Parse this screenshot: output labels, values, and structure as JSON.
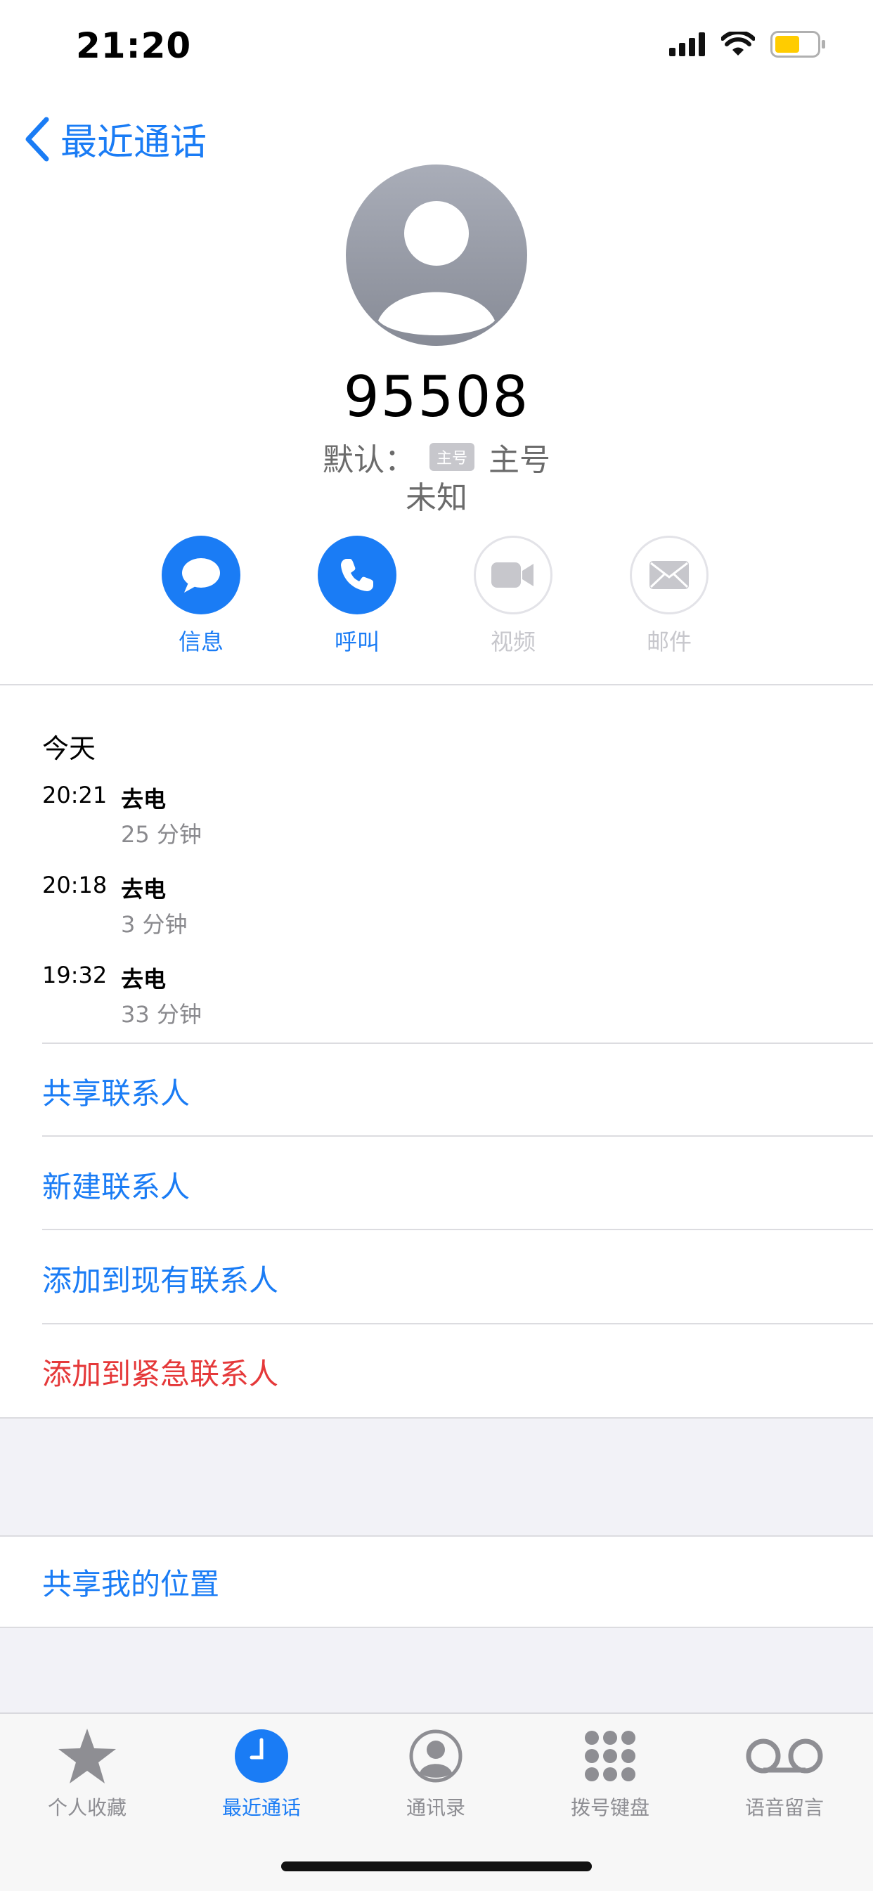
{
  "status_bar": {
    "time": "21:20"
  },
  "nav": {
    "back_label": "最近通话"
  },
  "contact": {
    "number": "95508",
    "default_label": "默认：",
    "tag": "主号",
    "line_label": "主号",
    "location": "未知"
  },
  "actions": [
    {
      "label": "信息",
      "icon": "message-icon",
      "enabled": true
    },
    {
      "label": "呼叫",
      "icon": "phone-icon",
      "enabled": true
    },
    {
      "label": "视频",
      "icon": "video-icon",
      "enabled": false
    },
    {
      "label": "邮件",
      "icon": "mail-icon",
      "enabled": false
    }
  ],
  "recents": {
    "title": "今天",
    "calls": [
      {
        "time": "20:21",
        "type": "去电",
        "duration": "25 分钟"
      },
      {
        "time": "20:18",
        "type": "去电",
        "duration": "3 分钟"
      },
      {
        "time": "19:32",
        "type": "去电",
        "duration": "33 分钟"
      }
    ]
  },
  "menu": [
    {
      "label": "共享联系人"
    },
    {
      "label": "新建联系人"
    },
    {
      "label": "添加到现有联系人"
    },
    {
      "label": "添加到紧急联系人"
    }
  ],
  "location_share": {
    "label": "共享我的位置"
  },
  "tabs": [
    {
      "label": "个人收藏",
      "icon": "star-icon",
      "active": false
    },
    {
      "label": "最近通话",
      "icon": "clock-icon",
      "active": true
    },
    {
      "label": "通讯录",
      "icon": "person-circle-icon",
      "active": false
    },
    {
      "label": "拨号键盘",
      "icon": "keypad-icon",
      "active": false
    },
    {
      "label": "语音留言",
      "icon": "voicemail-icon",
      "active": false
    }
  ],
  "colors": {
    "accent": "#1a7cf5",
    "destructive": "#e5393a",
    "battery": "#ffcc00"
  }
}
